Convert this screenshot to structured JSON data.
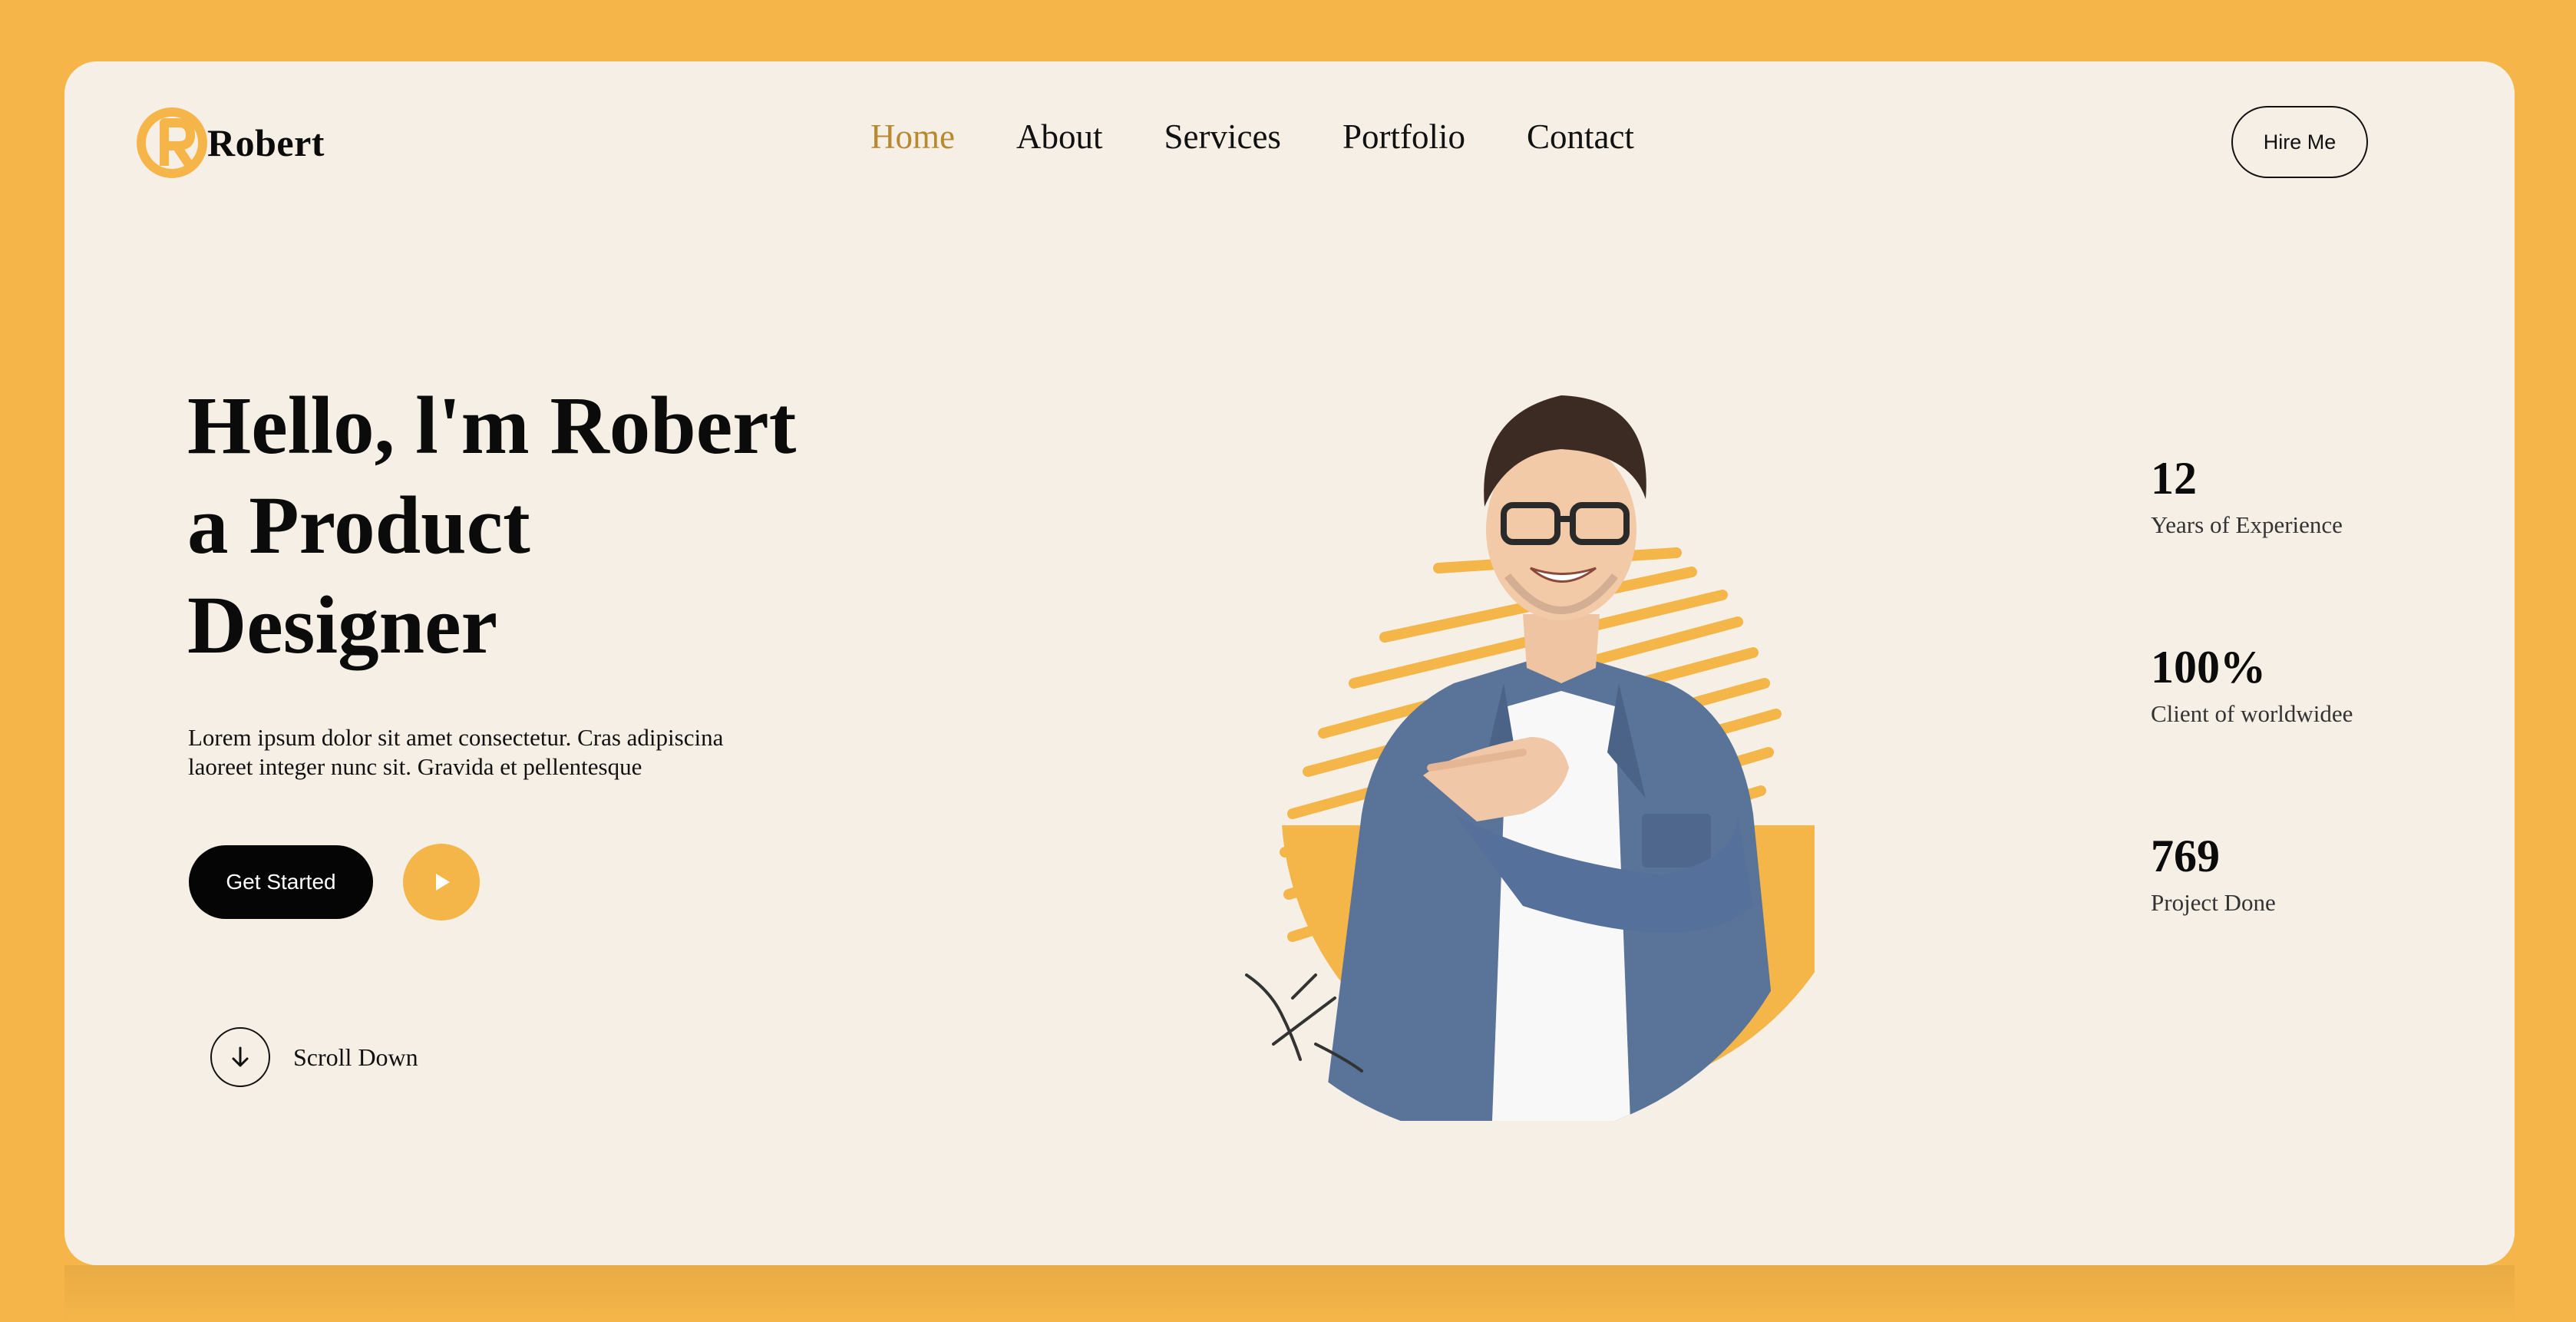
{
  "colors": {
    "accent": "#f5b548",
    "accent_dark": "#b8892e",
    "card_background": "#f6efe6",
    "text": "#0b0b0b"
  },
  "header": {
    "logo_icon": "r-monogram-logo",
    "logo_text": "Robert",
    "nav": [
      {
        "label": "Home",
        "active": true
      },
      {
        "label": "About",
        "active": false
      },
      {
        "label": "Services",
        "active": false
      },
      {
        "label": "Portfolio",
        "active": false
      },
      {
        "label": "Contact",
        "active": false
      }
    ],
    "hire_label": "Hire Me"
  },
  "hero": {
    "title_lines": [
      "Hello, l'm Robert",
      "a Product",
      "Designer"
    ],
    "description_lines": [
      "Lorem ipsum dolor sit amet consectetur. Cras adipiscina",
      "laoreet integer nunc sit. Gravida et pellentesque"
    ],
    "primary_button": "Get Started",
    "play_icon": "play-icon",
    "scroll_icon": "arrow-down-icon",
    "scroll_label": "Scroll Down"
  },
  "portrait": {
    "image": "smiling man in glasses and denim shirt pointing sideways over yellow scribble circle"
  },
  "stats": [
    {
      "value": "12",
      "label": "Years of Experience"
    },
    {
      "value": "100%",
      "label": "Client of worldwidee"
    },
    {
      "value": "769",
      "label": "Project Done"
    }
  ]
}
